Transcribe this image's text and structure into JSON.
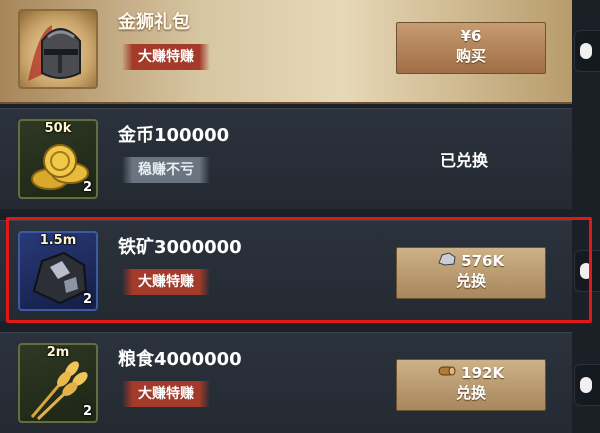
{
  "offers": [
    {
      "name": "金狮礼包",
      "tag": "大赚特赚",
      "icon": "knight-helmet-icon",
      "button": {
        "price": "¥6",
        "action": "购买"
      }
    },
    {
      "name": "金币100000",
      "tag": "稳赚不亏",
      "icon": "gold-coins-icon",
      "icon_qty": "50k",
      "icon_count": "2",
      "status": "已兑换"
    },
    {
      "name": "铁矿3000000",
      "tag": "大赚特赚",
      "icon": "iron-ore-icon",
      "icon_qty": "1.5m",
      "icon_count": "2",
      "button": {
        "cost": "576K",
        "cost_icon": "iron-ore-icon",
        "action": "兑换"
      }
    },
    {
      "name": "粮食4000000",
      "tag": "大赚特赚",
      "icon": "wheat-icon",
      "icon_qty": "2m",
      "icon_count": "2",
      "button": {
        "cost": "192K",
        "cost_icon": "wood-log-icon",
        "action": "兑换"
      }
    }
  ],
  "colors": {
    "highlight_border": "#e01818",
    "tag_red": "#a33a2a",
    "tag_grey": "#6b7580",
    "button_gold": "#b8966a"
  }
}
